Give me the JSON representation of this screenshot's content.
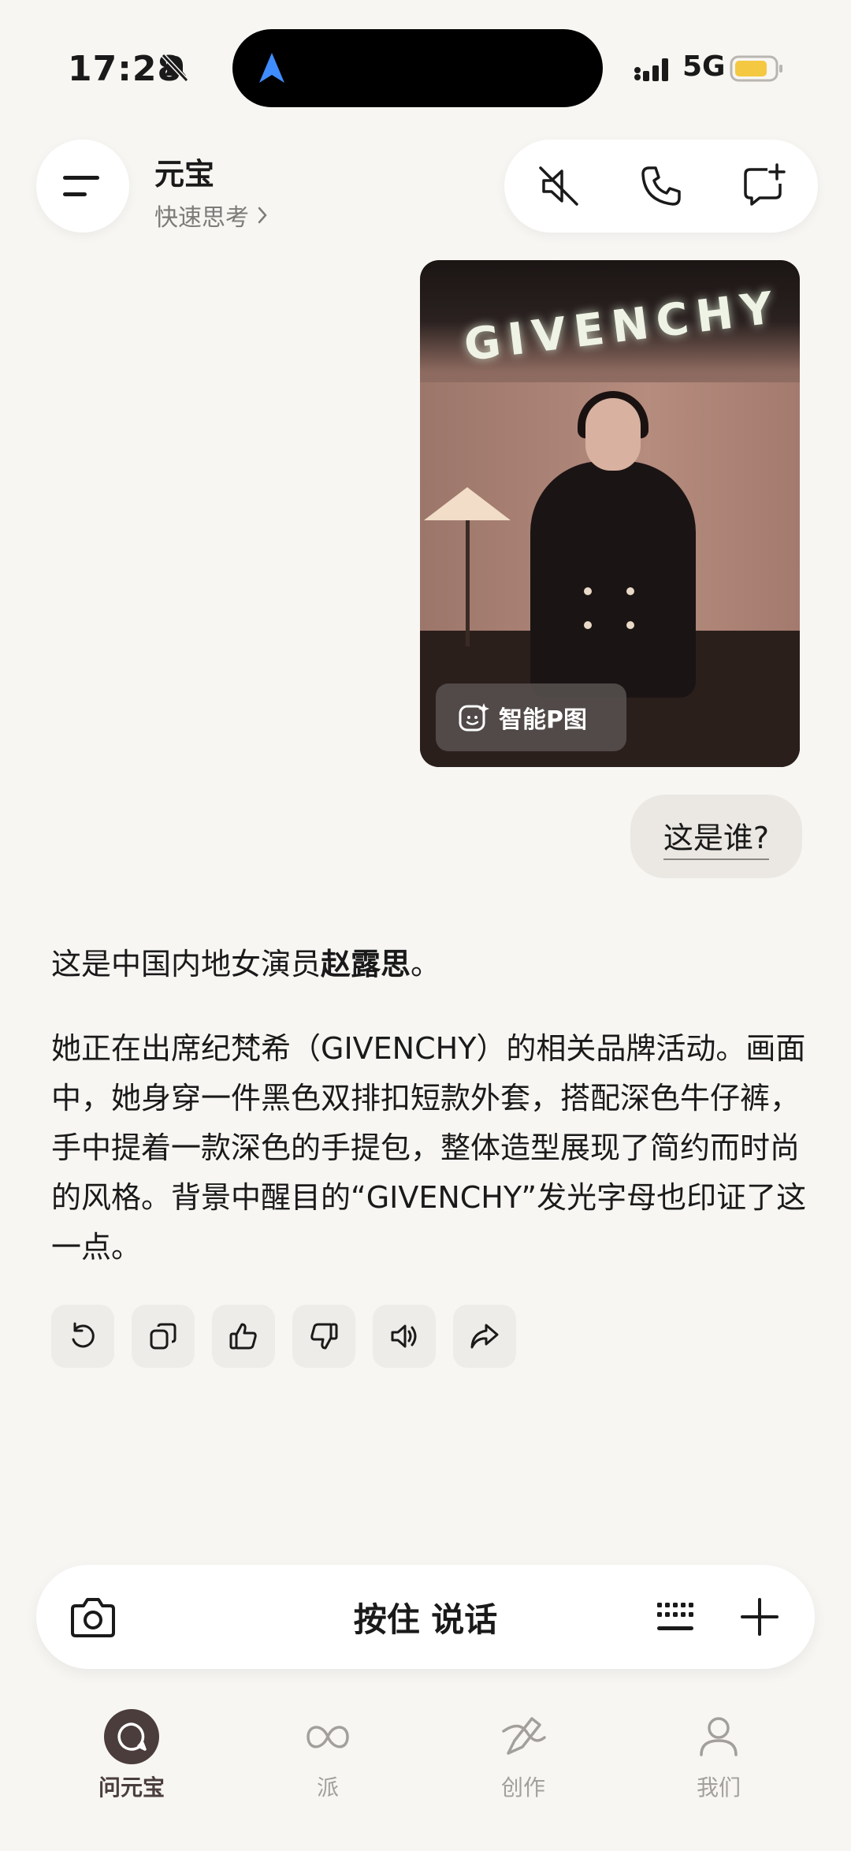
{
  "status_bar": {
    "time": "17:28",
    "network": "5G",
    "icons": [
      "bell-muted-icon",
      "navigation-arrow-icon",
      "signal-icon",
      "battery-icon"
    ]
  },
  "header": {
    "title": "元宝",
    "mode": "快速思考",
    "actions": [
      "mute-icon",
      "phone-icon",
      "new-chat-icon"
    ]
  },
  "chat": {
    "image_brand": "GIVENCHY",
    "smart_edit_label": "智能P图",
    "user_question": "这是谁?",
    "answer_p1_prefix": "这是中国内地女演员",
    "answer_p1_name": "赵露思",
    "answer_p1_suffix": "。",
    "answer_p2": "她正在出席纪梵希（GIVENCHY）的相关品牌活动。画面中，她身穿一件黑色双排扣短款外套，搭配深色牛仔裤，手中提着一款深色的手提包，整体造型展现了简约而时尚的风格。背景中醒目的“GIVENCHY”发光字母也印证了这一点。",
    "tools": [
      "refresh-icon",
      "copy-icon",
      "thumbs-up-icon",
      "thumbs-down-icon",
      "speaker-icon",
      "share-icon"
    ]
  },
  "input": {
    "hold_to_talk": "按住 说话"
  },
  "tabs": [
    {
      "label": "问元宝",
      "icon": "chat-icon",
      "active": true
    },
    {
      "label": "派",
      "icon": "infinity-icon",
      "active": false
    },
    {
      "label": "创作",
      "icon": "create-icon",
      "active": false
    },
    {
      "label": "我们",
      "icon": "profile-icon",
      "active": false
    }
  ],
  "colors": {
    "background": "#f7f6f3",
    "accent": "#4b3d3c",
    "muted_text": "#a3a09c",
    "battery": "#f5c842"
  }
}
